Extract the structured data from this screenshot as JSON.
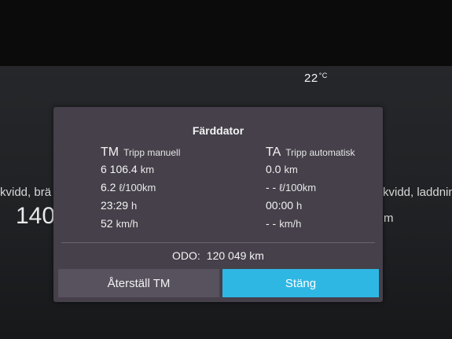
{
  "status": {
    "temperature": "22",
    "temperature_unit": "°C"
  },
  "background": {
    "left_label": "kvidd, brä",
    "left_value": "140",
    "right_label": "kvidd, laddnin",
    "right_value": "m"
  },
  "dialog": {
    "title": "Färddator",
    "manual": {
      "abbr": "TM",
      "name": "Tripp manuell",
      "distance": {
        "value": "6 106.4",
        "unit": "km"
      },
      "consumption": {
        "value": "6.2",
        "unit": "ℓ/100km"
      },
      "time": {
        "value": "23:29",
        "unit": "h"
      },
      "speed": {
        "value": "52",
        "unit": "km/h"
      }
    },
    "auto": {
      "abbr": "TA",
      "name": "Tripp automatisk",
      "distance": {
        "value": "0.0",
        "unit": "km"
      },
      "consumption": {
        "value": "- -",
        "unit": "ℓ/100km"
      },
      "time": {
        "value": "00:00",
        "unit": "h"
      },
      "speed": {
        "value": "- -",
        "unit": "km/h"
      }
    },
    "odo": {
      "label": "ODO:",
      "value": "120 049",
      "unit": "km"
    },
    "buttons": {
      "reset_label": "Återställ TM",
      "close_label": "Stäng"
    },
    "colors": {
      "dialog_bg": "#45404a",
      "close_button": "#2fb7e4",
      "reset_button": "#58525e"
    }
  }
}
